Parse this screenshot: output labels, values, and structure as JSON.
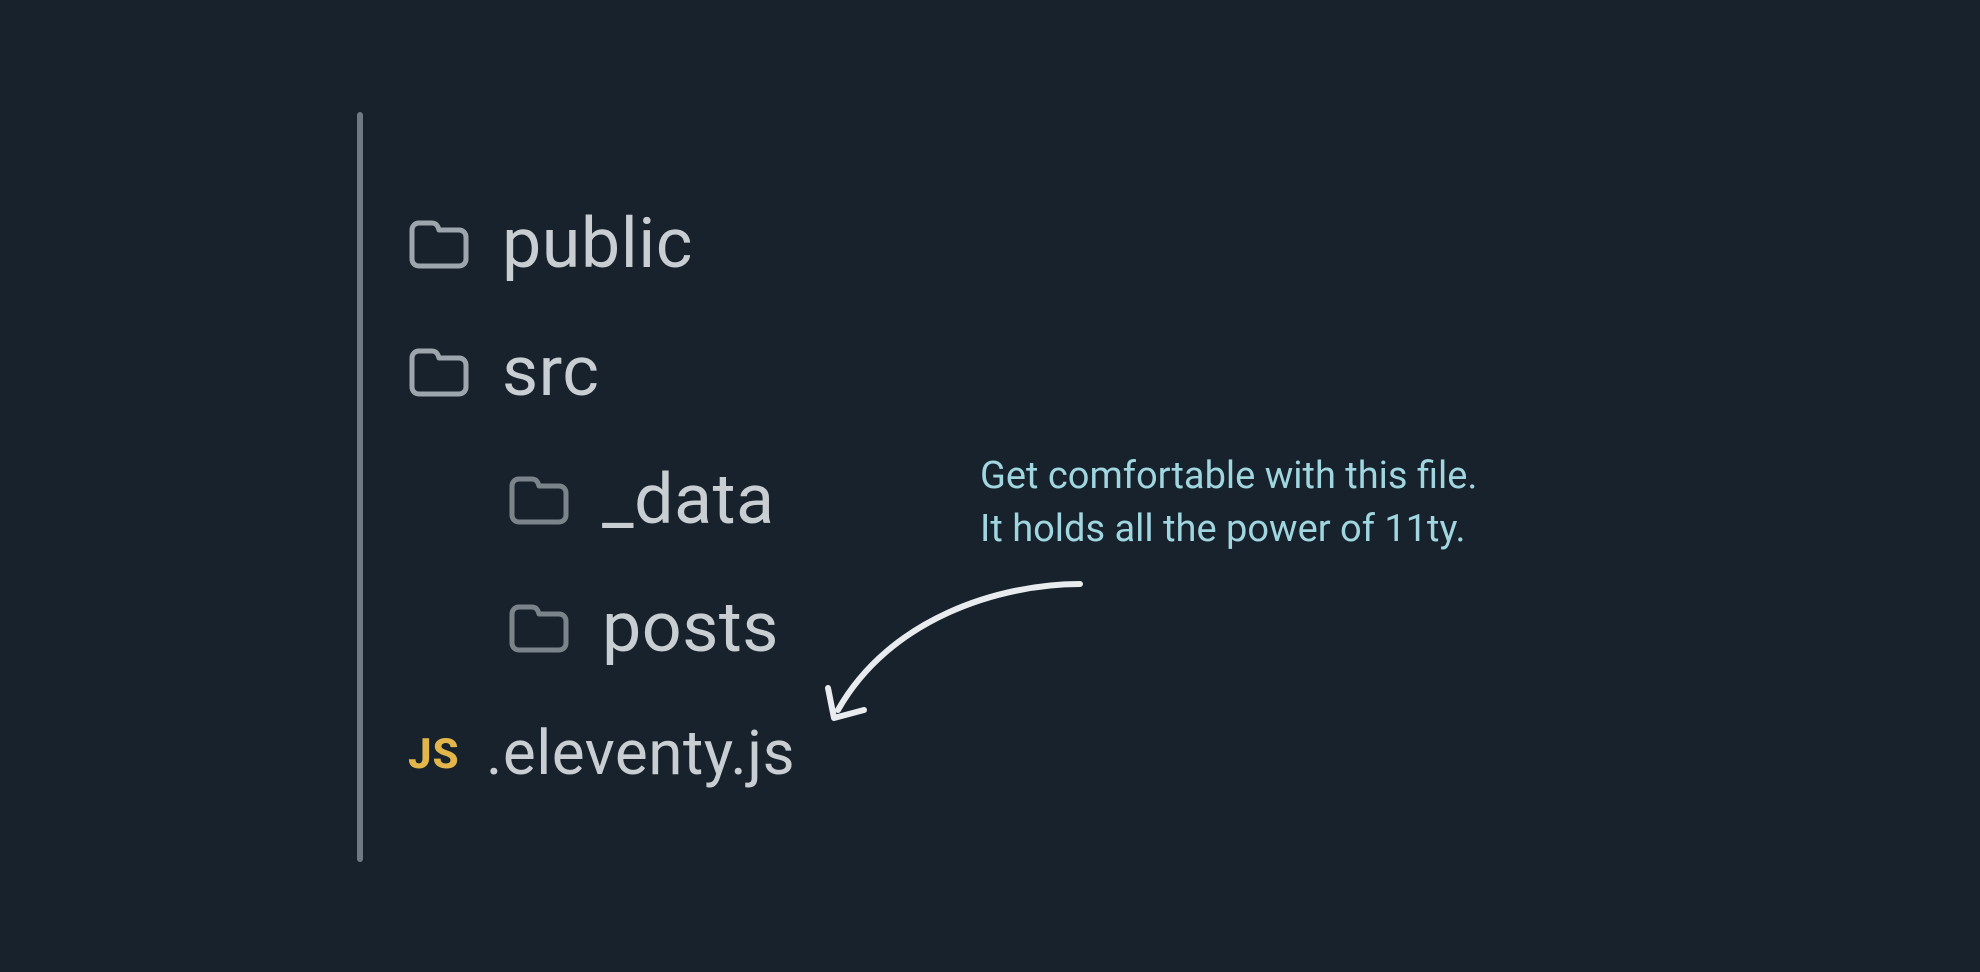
{
  "tree": {
    "items": [
      {
        "type": "folder",
        "name": "public",
        "indent": 0
      },
      {
        "type": "folder",
        "name": "src",
        "indent": 0
      },
      {
        "type": "folder",
        "name": "_data",
        "indent": 1
      },
      {
        "type": "folder",
        "name": "posts",
        "indent": 1
      },
      {
        "type": "js",
        "name": ".eleventy.js",
        "indent": 0
      }
    ]
  },
  "annotation": {
    "line1": "Get comfortable with this file.",
    "line2": "It holds all the power of 11ty."
  },
  "icons": {
    "js_label": "JS"
  },
  "colors": {
    "background": "#18222c",
    "text": "#c9ced3",
    "annotation": "#a0d6e0",
    "js_icon": "#e3b64b",
    "rule": "#6f7983"
  }
}
